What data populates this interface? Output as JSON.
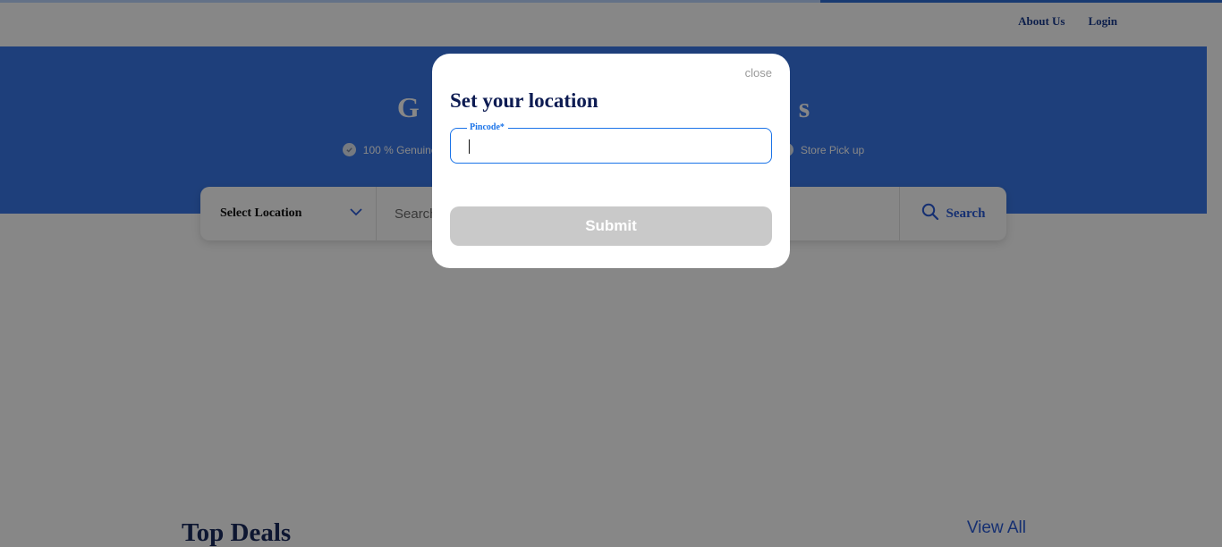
{
  "progress": {
    "fraction": 0.671
  },
  "topnav": {
    "about_us": "About Us",
    "login": "Login"
  },
  "hero": {
    "title": "G                                                     s",
    "features": [
      {
        "label": "100 % Genuine M"
      },
      {
        "label": "Store Pick up"
      }
    ]
  },
  "searchbar": {
    "location_label": "Select Location",
    "search_placeholder": "Search",
    "search_button": "Search"
  },
  "deals": {
    "title": "Top Deals",
    "view_all": "View All"
  },
  "modal": {
    "close": "close",
    "title": "Set your location",
    "pincode_label": "Pincode*",
    "pincode_value": "",
    "submit": "Submit"
  },
  "colors": {
    "brand_blue": "#3a78e8",
    "title_navy": "#0d1b52",
    "field_blue": "#1a73e8",
    "submit_disabled": "#c9c9c9"
  }
}
